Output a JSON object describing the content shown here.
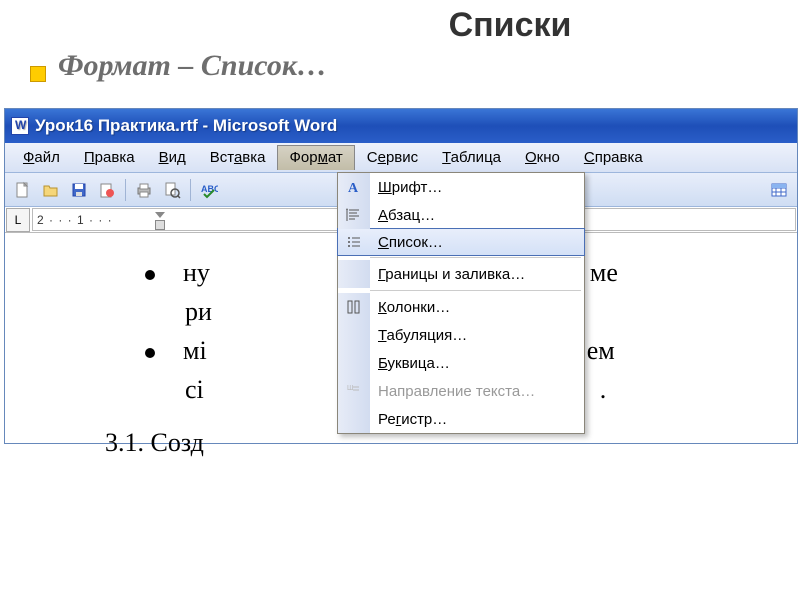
{
  "slide": {
    "title": "Списки",
    "subtitle": "Формат – Список…"
  },
  "window": {
    "title": "Урок16 Практика.rtf - Microsoft Word"
  },
  "menubar": {
    "file": "Файл",
    "edit": "Правка",
    "view": "Вид",
    "insert": "Вставка",
    "format": "Формат",
    "tools": "Сервис",
    "table": "Таблица",
    "window": "Окно",
    "help": "Справка"
  },
  "ruler": {
    "scale_text": "2 · · · 1 · · · ",
    "tab_button": "L"
  },
  "document": {
    "line1a": "ну",
    "line1b": "ме",
    "line2": "ри",
    "line3a": "мі",
    "line3b": "ем",
    "line4a": "сі",
    "line4b": ".",
    "line5": "3.1. Созд"
  },
  "dropdown": {
    "font": "Шрифт…",
    "paragraph": "Абзац…",
    "list": "Список…",
    "borders": "Границы и заливка…",
    "columns": "Колонки…",
    "tabs": "Табуляция…",
    "dropcap": "Буквица…",
    "textdir": "Направление текста…",
    "register": "Регистр…"
  }
}
